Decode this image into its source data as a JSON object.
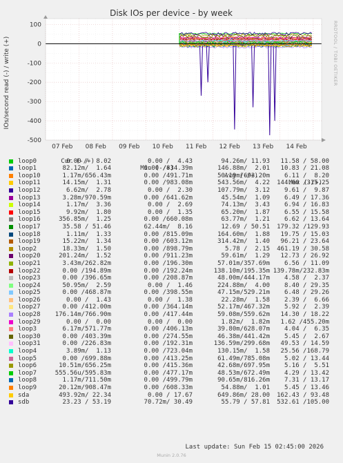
{
  "chart_data": {
    "type": "line",
    "title": "Disk IOs per device - by week",
    "ylabel": "IOs/second read (-) / write (+)",
    "side_label": "RRDTOOL / TOBI OETIKER",
    "xlabels": [
      "07 Feb",
      "08 Feb",
      "09 Feb",
      "10 Feb",
      "11 Feb",
      "12 Feb",
      "13 Feb",
      "14 Feb"
    ],
    "yticks": [
      100,
      0,
      -100,
      -200,
      -300,
      -400,
      -500
    ],
    "ylim": [
      -500,
      130
    ],
    "grid": true,
    "data_start_day": 4.0,
    "series_notes": "Data begins around 11 Feb; mostly within -20..+60, with deep read dips on loop13",
    "dips": [
      {
        "day": 4.65,
        "value": -270
      },
      {
        "day": 4.85,
        "value": -200
      },
      {
        "day": 5.65,
        "value": -445
      },
      {
        "day": 6.2,
        "value": -330
      },
      {
        "day": 6.7,
        "value": -475
      },
      {
        "day": 6.85,
        "value": -400
      }
    ]
  },
  "legend": {
    "headers": {
      "cur": "Cur (-/+)",
      "min": "Min (-/+)",
      "avg": "Avg (-/+)",
      "max": "Max (-/+)"
    },
    "rows": [
      {
        "name": "loop0",
        "color": "#00cc00",
        "cur": "0.00 /  8.02",
        "min": "0.00 /  4.43",
        "avg": "94.26m/ 11.93",
        "max": "11.58 / 58.00"
      },
      {
        "name": "loop1",
        "color": "#0066b3",
        "cur": "82.12m/  1.64",
        "min": "0.00 /834.39m",
        "avg": "146.88m/  2.01",
        "max": "10.83 / 21.08"
      },
      {
        "name": "loop10",
        "color": "#ff8000",
        "cur": "1.17m/656.43m",
        "min": "0.00 /491.71m",
        "avg": "50.19m/693.20m",
        "max": "6.11 /  8.20"
      },
      {
        "name": "loop11",
        "color": "#ffcc00",
        "cur": "14.15m/  1.31",
        "min": "0.00 /983.08m",
        "avg": "543.56m/  4.22",
        "max": "144.60 /315.25"
      },
      {
        "name": "loop12",
        "color": "#330099",
        "cur": "6.62m/  2.78",
        "min": "0.00 /  2.30",
        "avg": "107.79m/  3.12",
        "max": "9.61 /  9.87"
      },
      {
        "name": "loop13",
        "color": "#990099",
        "cur": "3.28m/970.59m",
        "min": "0.00 /641.62m",
        "avg": "45.54m/  1.09",
        "max": "6.49 / 17.36"
      },
      {
        "name": "loop14",
        "color": "#ccff00",
        "cur": "1.17m/  3.36",
        "min": "0.00 /  2.69",
        "avg": "74.13m/  3.43",
        "max": "6.94 / 16.83"
      },
      {
        "name": "loop15",
        "color": "#ff0000",
        "cur": "9.92m/  1.80",
        "min": "0.00 /  1.35",
        "avg": "65.20m/  1.87",
        "max": "6.55 / 15.58"
      },
      {
        "name": "loop16",
        "color": "#808080",
        "cur": "356.85m/  1.25",
        "min": "0.00 /660.08m",
        "avg": "63.77m/  1.21",
        "max": "6.62 / 13.64"
      },
      {
        "name": "loop17",
        "color": "#008f00",
        "cur": "35.58 / 51.46",
        "min": "62.44m/  8.16",
        "avg": "12.69 / 50.51",
        "max": "179.32 /129.93"
      },
      {
        "name": "loop18",
        "color": "#00487d",
        "cur": "1.11m/  1.33",
        "min": "0.00 /815.09m",
        "avg": "164.60m/  1.88",
        "max": "19.75 / 15.03"
      },
      {
        "name": "loop19",
        "color": "#b35a00",
        "cur": "15.22m/  1.34",
        "min": "0.00 /603.12m",
        "avg": "314.42m/  1.40",
        "max": "96.21 / 23.64"
      },
      {
        "name": "loop2",
        "color": "#b38f00",
        "cur": "18.33m/  1.50",
        "min": "0.00 /898.79m",
        "avg": "5.78 /  2.15",
        "max": "461.19 / 30.58"
      },
      {
        "name": "loop20",
        "color": "#6b006b",
        "cur": "201.24m/  1.52",
        "min": "0.00 /911.23m",
        "avg": "59.61m/  1.29",
        "max": "12.73 / 26.92"
      },
      {
        "name": "loop21",
        "color": "#8fb300",
        "cur": "3.43m/262.82m",
        "min": "0.00 /196.30m",
        "avg": "57.01m/357.69m",
        "max": "6.56 / 11.09"
      },
      {
        "name": "loop22",
        "color": "#b30000",
        "cur": "0.00 /194.89m",
        "min": "0.00 /192.24m",
        "avg": "138.10m/195.35m",
        "max": "139.78m/232.83m"
      },
      {
        "name": "loop23",
        "color": "#bebebe",
        "cur": "0.00 /396.65m",
        "min": "0.00 /208.87m",
        "avg": "48.00m/444.17m",
        "max": "4.58 /  2.37"
      },
      {
        "name": "loop24",
        "color": "#80ff80",
        "cur": "50.95m/  2.59",
        "min": "0.00 /  1.46",
        "avg": "224.88m/  4.00",
        "max": "8.40 / 29.35"
      },
      {
        "name": "loop25",
        "color": "#80c9ff",
        "cur": "0.00 /468.87m",
        "min": "0.00 /398.55m",
        "avg": "47.15m/529.21m",
        "max": "6.48 / 29.26"
      },
      {
        "name": "loop26",
        "color": "#ffc080",
        "cur": "0.00 /  1.43",
        "min": "0.00 /  1.38",
        "avg": "22.28m/  1.58",
        "max": "2.39 /  6.66"
      },
      {
        "name": "loop27",
        "color": "#ffe680",
        "cur": "0.00 /412.00m",
        "min": "0.00 /364.14m",
        "avg": "52.17m/467.32m",
        "max": "5.92 /  2.39"
      },
      {
        "name": "loop28",
        "color": "#aa80ff",
        "cur": "176.14m/766.90m",
        "min": "0.00 /417.44m",
        "avg": "59.08m/559.62m",
        "max": "14.30 / 18.22"
      },
      {
        "name": "loop29",
        "color": "#ee00cc",
        "cur": "0.00 /  0.00",
        "min": "0.00 /  0.00",
        "avg": "1.82m/  1.82m",
        "max": "1.62 /455.20m"
      },
      {
        "name": "loop3",
        "color": "#ff8080",
        "cur": "6.17m/571.77m",
        "min": "0.00 /406.13m",
        "avg": "39.80m/628.07m",
        "max": "4.04 /  6.35"
      },
      {
        "name": "loop30",
        "color": "#666600",
        "cur": "0.00 /403.39m",
        "min": "0.00 /274.55m",
        "avg": "46.38m/441.42m",
        "max": "5.45 /  2.67"
      },
      {
        "name": "loop31",
        "color": "#ffbfff",
        "cur": "0.00 /226.83m",
        "min": "0.00 /192.31m",
        "avg": "136.59m/299.68m",
        "max": "49.53 / 14.59"
      },
      {
        "name": "loop4",
        "color": "#00ffcc",
        "cur": "3.89m/  1.13",
        "min": "0.00 /723.04m",
        "avg": "130.15m/  1.58",
        "max": "25.56 /168.79"
      },
      {
        "name": "loop5",
        "color": "#cc6699",
        "cur": "0.00 /699.88m",
        "min": "0.00 /413.25m",
        "avg": "61.49m/785.08m",
        "max": "5.02 / 13.44"
      },
      {
        "name": "loop6",
        "color": "#999900",
        "cur": "10.51m/656.25m",
        "min": "0.00 /415.36m",
        "avg": "42.68m/697.95m",
        "max": "5.16 /  5.51"
      },
      {
        "name": "loop7",
        "color": "#00cc00",
        "cur": "555.56u/595.83m",
        "min": "0.00 /477.17m",
        "avg": "48.53m/672.49m",
        "max": "4.29 / 13.42"
      },
      {
        "name": "loop8",
        "color": "#0066b3",
        "cur": "1.17m/711.50m",
        "min": "0.00 /499.79m",
        "avg": "90.65m/816.26m",
        "max": "7.31 / 13.17"
      },
      {
        "name": "loop9",
        "color": "#ff8000",
        "cur": "20.12m/908.47m",
        "min": "0.00 /608.33m",
        "avg": "54.88m/  1.01",
        "max": "5.45 / 13.46"
      },
      {
        "name": "sda",
        "color": "#ffcc00",
        "cur": "493.92m/ 22.34",
        "min": "0.00 / 17.67",
        "avg": "649.86m/ 28.00",
        "max": "162.43 / 93.48"
      },
      {
        "name": "sdb",
        "color": "#330099",
        "cur": "23.23 / 53.19",
        "min": "70.72m/ 30.49",
        "avg": "55.79 / 57.81",
        "max": "532.61 /105.00"
      }
    ]
  },
  "footer": {
    "last_update": "Last update:  Sun Feb 15 02:45:00 2026",
    "munin": "Munin 2.0.76"
  }
}
